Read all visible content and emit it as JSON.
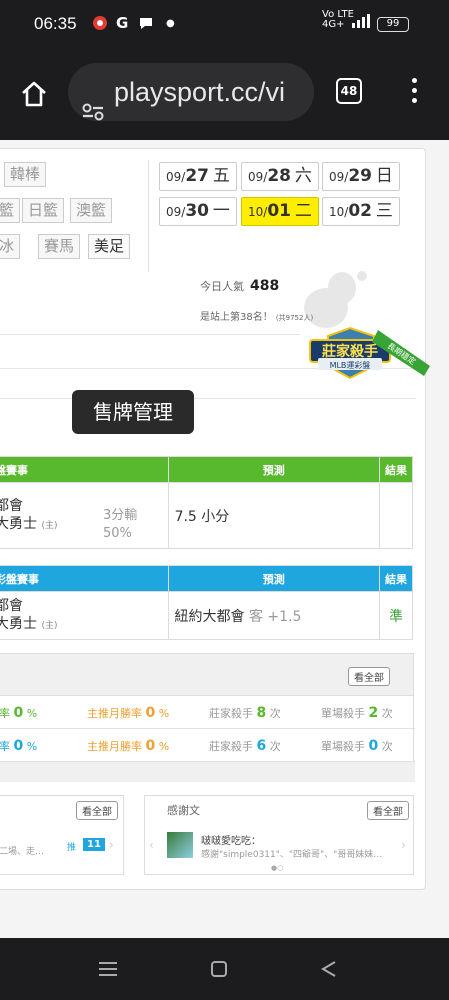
{
  "status": {
    "time": "06:35",
    "network": "Vo LTE",
    "network2": "4G+",
    "battery": "99"
  },
  "browser": {
    "url": "playsport.cc/vi",
    "tab_count": "48"
  },
  "sports": {
    "row1": [
      "韓棒"
    ],
    "row2": [
      "籃",
      "日籃",
      "澳籃"
    ],
    "row3": [
      "冰",
      "賽馬",
      "美足"
    ]
  },
  "dates": [
    {
      "md": "09/",
      "d": "27",
      "w": "五"
    },
    {
      "md": "09/",
      "d": "28",
      "w": "六"
    },
    {
      "md": "09/",
      "d": "29",
      "w": "日"
    },
    {
      "md": "09/",
      "d": "30",
      "w": "一"
    },
    {
      "md": "10/",
      "d": "01",
      "w": "二"
    },
    {
      "md": "10/",
      "d": "02",
      "w": "三"
    }
  ],
  "popularity": {
    "label": "今日人氣",
    "value": "488",
    "rank_text": "是站上第38名！",
    "rank_extra": "(共9752人)"
  },
  "badge": {
    "title": "莊家殺手",
    "sub": "MLB運彩盤",
    "ribbon": "長期穩定"
  },
  "toast": "售牌管理",
  "table1": {
    "header": [
      "盤賽事",
      "預測",
      "結果"
    ],
    "team1": "都會",
    "team2": "大勇士",
    "team2_tag": "(主)",
    "odds1": "3分輸",
    "odds2": "50%",
    "prediction": "7.5 小分",
    "result": ""
  },
  "table2": {
    "header": [
      "彩盤賽事",
      "預測",
      "結果"
    ],
    "team1": "都會",
    "team2": "大勇士",
    "team2_tag": "(主)",
    "prediction": "紐約大都會",
    "prediction_side": "客 +1.5",
    "result": "準"
  },
  "stats": {
    "view_all": "看全部",
    "rows": [
      {
        "a_label": "率",
        "a_val": "0",
        "b_label": "主推月勝率",
        "b_val": "0",
        "c_label": "莊家殺手",
        "c_val": "8",
        "c_unit": "次",
        "d_label": "單場殺手",
        "d_val": "2",
        "d_unit": "次"
      },
      {
        "a_label": "率",
        "a_val": "0",
        "b_label": "主推月勝率",
        "b_val": "0",
        "c_label": "莊家殺手",
        "c_val": "6",
        "c_unit": "次",
        "d_label": "單場殺手",
        "d_val": "0",
        "d_unit": "次"
      }
    ],
    "percent": "%"
  },
  "left_box": {
    "view_all": "看全部",
    "snippet": "二場、走…",
    "push_label": "推",
    "push_count": "11"
  },
  "thanks": {
    "title": "感謝文",
    "view_all": "看全部",
    "user": "啵啵愛吃吃：",
    "text": "感謝\"simple0311\"、\"四爺哥\"、\"哥哥妹妹…"
  },
  "colors": {
    "green_header": "#58b82e",
    "blue_header": "#1fa6de",
    "active_date": "#ffee00",
    "win": "#3aa335"
  }
}
